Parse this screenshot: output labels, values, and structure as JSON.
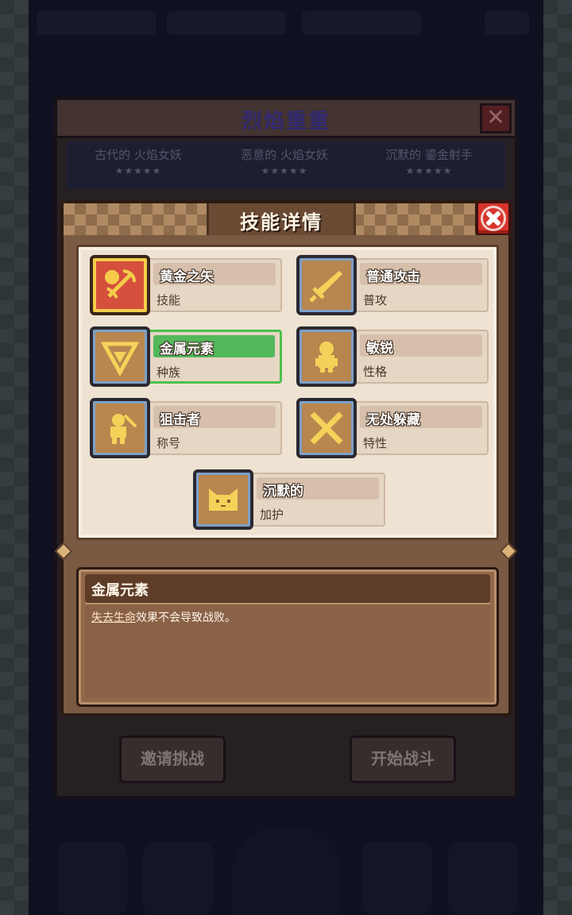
{
  "stage": {
    "title": "烈焰重重",
    "enemies": [
      {
        "name": "古代的 火焰女妖",
        "stars": "★★★★★"
      },
      {
        "name": "恶意的 火焰女妖",
        "stars": "★★★★★"
      },
      {
        "name": "沉默的 鎏金射手",
        "stars": "★★★★★"
      }
    ],
    "invite_button": "邀请挑战",
    "start_button": "开始战斗"
  },
  "dialog": {
    "title": "技能详情",
    "skills": [
      {
        "name": "黄金之矢",
        "type": "技能",
        "icon": "golden-arrow-icon"
      },
      {
        "name": "普通攻击",
        "type": "普攻",
        "icon": "sword-icon"
      },
      {
        "name": "金属元素",
        "type": "种族",
        "icon": "metal-element-icon"
      },
      {
        "name": "敏锐",
        "type": "性格",
        "icon": "keen-figure-icon"
      },
      {
        "name": "狙击者",
        "type": "称号",
        "icon": "sniper-figure-icon"
      },
      {
        "name": "无处躲藏",
        "type": "特性",
        "icon": "crossed-swords-icon"
      },
      {
        "name": "沉默的",
        "type": "加护",
        "icon": "cat-face-icon"
      }
    ],
    "selected_index": 2,
    "description": {
      "title": "金属元素",
      "link_text": "失去生命",
      "text": "效果不会导致战败。"
    }
  },
  "colors": {
    "selected": "#52b85a",
    "close": "#d8342c",
    "panel": "#eee2d2"
  }
}
